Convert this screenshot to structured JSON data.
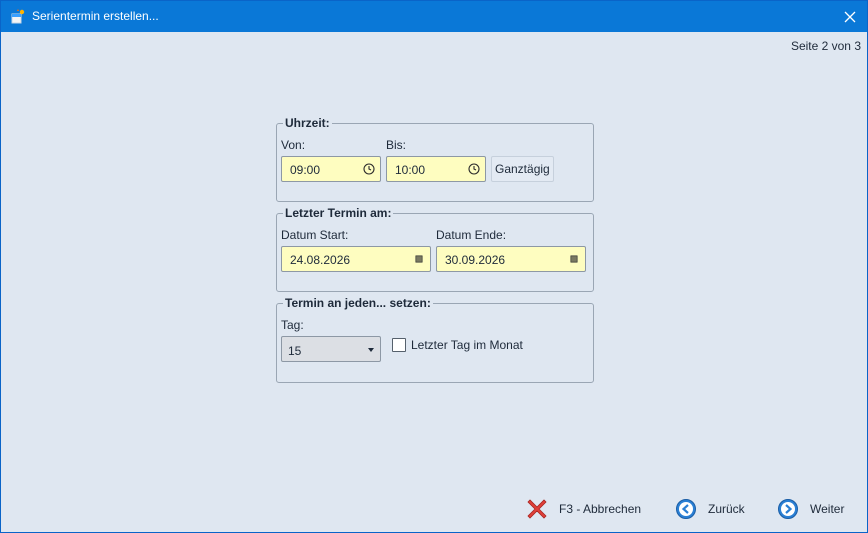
{
  "window": {
    "title": "Serientermin erstellen...",
    "page_indicator": "Seite 2 von 3"
  },
  "uhrzeit": {
    "group_title": "Uhrzeit:",
    "von_label": "Von:",
    "von_value": "09:00",
    "bis_label": "Bis:",
    "bis_value": "10:00",
    "ganztaegig_label": "Ganztägig"
  },
  "letzter_termin": {
    "group_title": "Letzter Termin am:",
    "start_label": "Datum Start:",
    "start_value": "24.08.2026",
    "end_label": "Datum Ende:",
    "end_value": "30.09.2026"
  },
  "termin_setzen": {
    "group_title": "Termin an jeden... setzen:",
    "tag_label": "Tag:",
    "tag_value": "15",
    "letzter_tag_label": "Letzter Tag im Monat",
    "letzter_tag_checked": false
  },
  "footer": {
    "cancel_label": "F3 - Abbrechen",
    "back_label": "Zurück",
    "next_label": "Weiter"
  },
  "colors": {
    "titlebar": "#0a78d7",
    "background": "#dfe7f1",
    "field_fill": "#fefdc0",
    "cancel_red": "#e0403a",
    "nav_blue": "#2a7fd4"
  }
}
